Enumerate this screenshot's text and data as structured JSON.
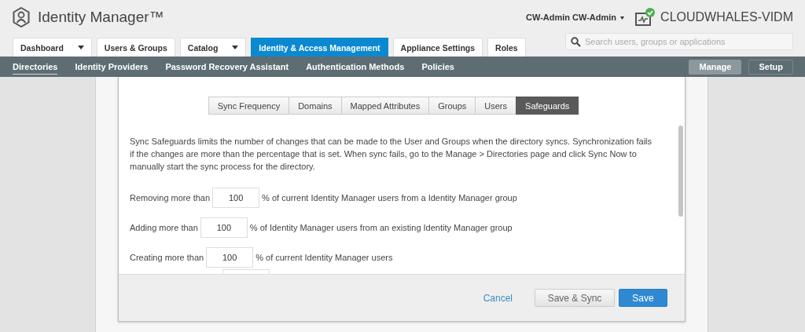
{
  "app": {
    "title": "Identity Manager™",
    "user": "CW-Admin CW-Admin",
    "tenant": "CLOUDWHALES-VIDM"
  },
  "search": {
    "placeholder": "Search users, groups or applications"
  },
  "main_tabs": [
    {
      "label": "Dashboard",
      "dropdown": true,
      "selected": false
    },
    {
      "label": "Users & Groups",
      "dropdown": false,
      "selected": false
    },
    {
      "label": "Catalog",
      "dropdown": true,
      "selected": false
    },
    {
      "label": "Identity & Access Management",
      "dropdown": false,
      "selected": true
    },
    {
      "label": "Appliance Settings",
      "dropdown": false,
      "selected": false
    },
    {
      "label": "Roles",
      "dropdown": false,
      "selected": false
    }
  ],
  "sub_nav": [
    {
      "label": "Directories",
      "selected": true
    },
    {
      "label": "Identity Providers",
      "selected": false
    },
    {
      "label": "Password Recovery Assistant",
      "selected": false
    },
    {
      "label": "Authentication Methods",
      "selected": false
    },
    {
      "label": "Policies",
      "selected": false
    }
  ],
  "mode_buttons": [
    {
      "label": "Manage",
      "selected": true
    },
    {
      "label": "Setup",
      "selected": false
    }
  ],
  "dialog": {
    "tabs": [
      {
        "label": "Sync Frequency",
        "selected": false
      },
      {
        "label": "Domains",
        "selected": false
      },
      {
        "label": "Mapped Attributes",
        "selected": false
      },
      {
        "label": "Groups",
        "selected": false
      },
      {
        "label": "Users",
        "selected": false
      },
      {
        "label": "Safeguards",
        "selected": true
      }
    ],
    "description": "Sync Safeguards limits the number of changes that can be made to the User and Groups when the directory syncs. Synchronization fails if the changes are more than the percentage that is set. When sync fails, go to the Manage > Directories page and click Sync Now to manually start the sync process for the directory.",
    "rows": [
      {
        "label": "Removing more than",
        "value": "100",
        "suffix": "% of current Identity Manager users from a Identity Manager group"
      },
      {
        "label": "Adding more than",
        "value": "100",
        "suffix": "% of Identity Manager users from an existing Identity Manager group"
      },
      {
        "label": "Creating more than",
        "value": "100",
        "suffix": "% of current Identity Manager users"
      }
    ],
    "buttons": [
      {
        "label": "Cancel",
        "kind": "link"
      },
      {
        "label": "Save & Sync",
        "kind": "secondary"
      },
      {
        "label": "Save",
        "kind": "primary"
      }
    ]
  }
}
